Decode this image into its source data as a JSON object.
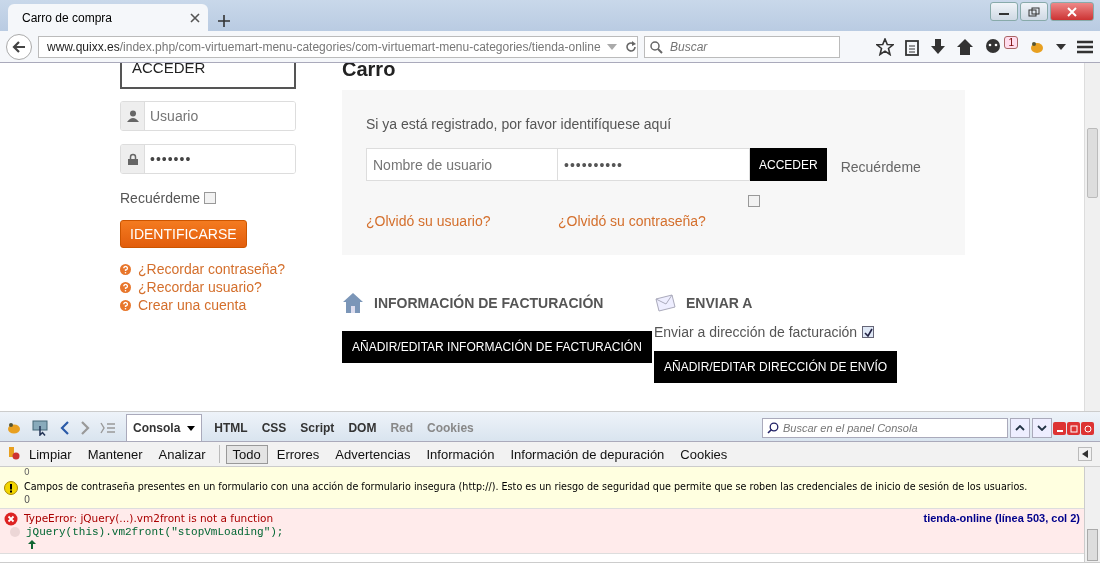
{
  "browser": {
    "tab": {
      "title": "Carro de compra"
    },
    "url": {
      "domain": "www.quixx.es",
      "path": "/index.php/com-virtuemart-menu-categories/com-virtuemart-menu-categories/tienda-online"
    },
    "search": {
      "placeholder": "Buscar"
    },
    "notification_badge": "1"
  },
  "sidebar": {
    "top_button": "ACCEDER",
    "username": {
      "placeholder": "Usuario"
    },
    "password": {
      "value": "•••••••"
    },
    "remember": {
      "label": "Recuérdeme",
      "checked": false
    },
    "login_button": "IDENTIFICARSE",
    "links": [
      "¿Recordar contraseña?",
      "¿Recordar usuario?",
      "Crear una cuenta"
    ]
  },
  "main": {
    "heading": "Carro",
    "login_box": {
      "intro": "Si ya está registrado, por favor identifíquese aquí",
      "username": {
        "placeholder": "Nombre de usuario"
      },
      "password": {
        "value": "••••••••••"
      },
      "button": "ACCEDER",
      "remember": {
        "label": "Recuérdeme",
        "checked": false
      },
      "links": [
        "¿Olvidó su usuario?",
        "¿Olvidó su contraseña?"
      ]
    },
    "billing": {
      "title": "INFORMACIÓN DE FACTURACIÓN",
      "button": "AÑADIR/EDITAR INFORMACIÓN DE FACTURACIÓN"
    },
    "shipping": {
      "title": "ENVIAR A",
      "same_address": {
        "label": "Enviar a dirección de facturación",
        "checked": true
      },
      "button": "AÑADIR/EDITAR DIRECCIÓN DE ENVÍO"
    }
  },
  "devtools": {
    "panels": [
      {
        "label": "Consola",
        "selected": true,
        "disabled": false
      },
      {
        "label": "HTML",
        "selected": false,
        "disabled": false
      },
      {
        "label": "CSS",
        "selected": false,
        "disabled": false
      },
      {
        "label": "Script",
        "selected": false,
        "disabled": false
      },
      {
        "label": "DOM",
        "selected": false,
        "disabled": false
      },
      {
        "label": "Red",
        "selected": false,
        "disabled": true
      },
      {
        "label": "Cookies",
        "selected": false,
        "disabled": true
      }
    ],
    "search": {
      "placeholder": "Buscar en el panel Consola"
    },
    "actions": [
      "Limpiar",
      "Mantener",
      "Analizar"
    ],
    "filters": [
      {
        "label": "Todo",
        "selected": true
      },
      {
        "label": "Errores",
        "selected": false
      },
      {
        "label": "Advertencias",
        "selected": false
      },
      {
        "label": "Información",
        "selected": false
      },
      {
        "label": "Información de depuración",
        "selected": false
      },
      {
        "label": "Cookies",
        "selected": false
      }
    ],
    "messages": [
      {
        "kind": "plain",
        "text": "0"
      },
      {
        "kind": "warning",
        "text": "Campos de contraseña presentes en un formulario con una acción de formulario insegura (http://). Esto es un riesgo de seguridad que permite que se roben las credenciales de inicio de sesión de los usuarios.",
        "detail": "0"
      },
      {
        "kind": "error",
        "text": "TypeError: jQuery(...).vm2front is not a function",
        "source": "tienda-online (línea 503, col 2)",
        "code": "jQuery(this).vm2front(\"stopVmLoading\");"
      }
    ]
  }
}
